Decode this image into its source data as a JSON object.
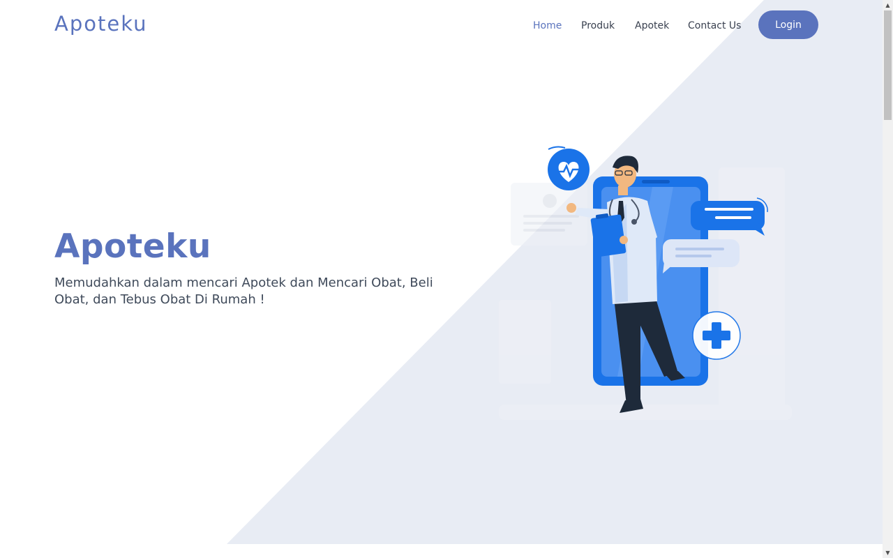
{
  "nav": {
    "brand": "Apoteku",
    "links": [
      "Home",
      "Produk",
      "Apotek",
      "Contact Us"
    ],
    "active_link": "Home",
    "login_label": "Login"
  },
  "hero": {
    "title": "Apoteku",
    "subtitle": "Memudahkan dalam mencari Apotek dan Mencari Obat, Beli Obat, dan Tebus Obat Di Rumah !"
  },
  "illustration": {
    "icons": [
      "heartbeat-icon",
      "chat-bubble-icon",
      "plus-cross-icon",
      "doctor-figure",
      "smartphone"
    ]
  },
  "colors": {
    "brand": "#5a73bd",
    "hero_triangle": "#e8ecf4",
    "illustration_blue": "#1a73e8",
    "text_dark": "#3f4a5a"
  },
  "scrollbar": {
    "up_glyph": "▲",
    "down_glyph": "▼"
  }
}
